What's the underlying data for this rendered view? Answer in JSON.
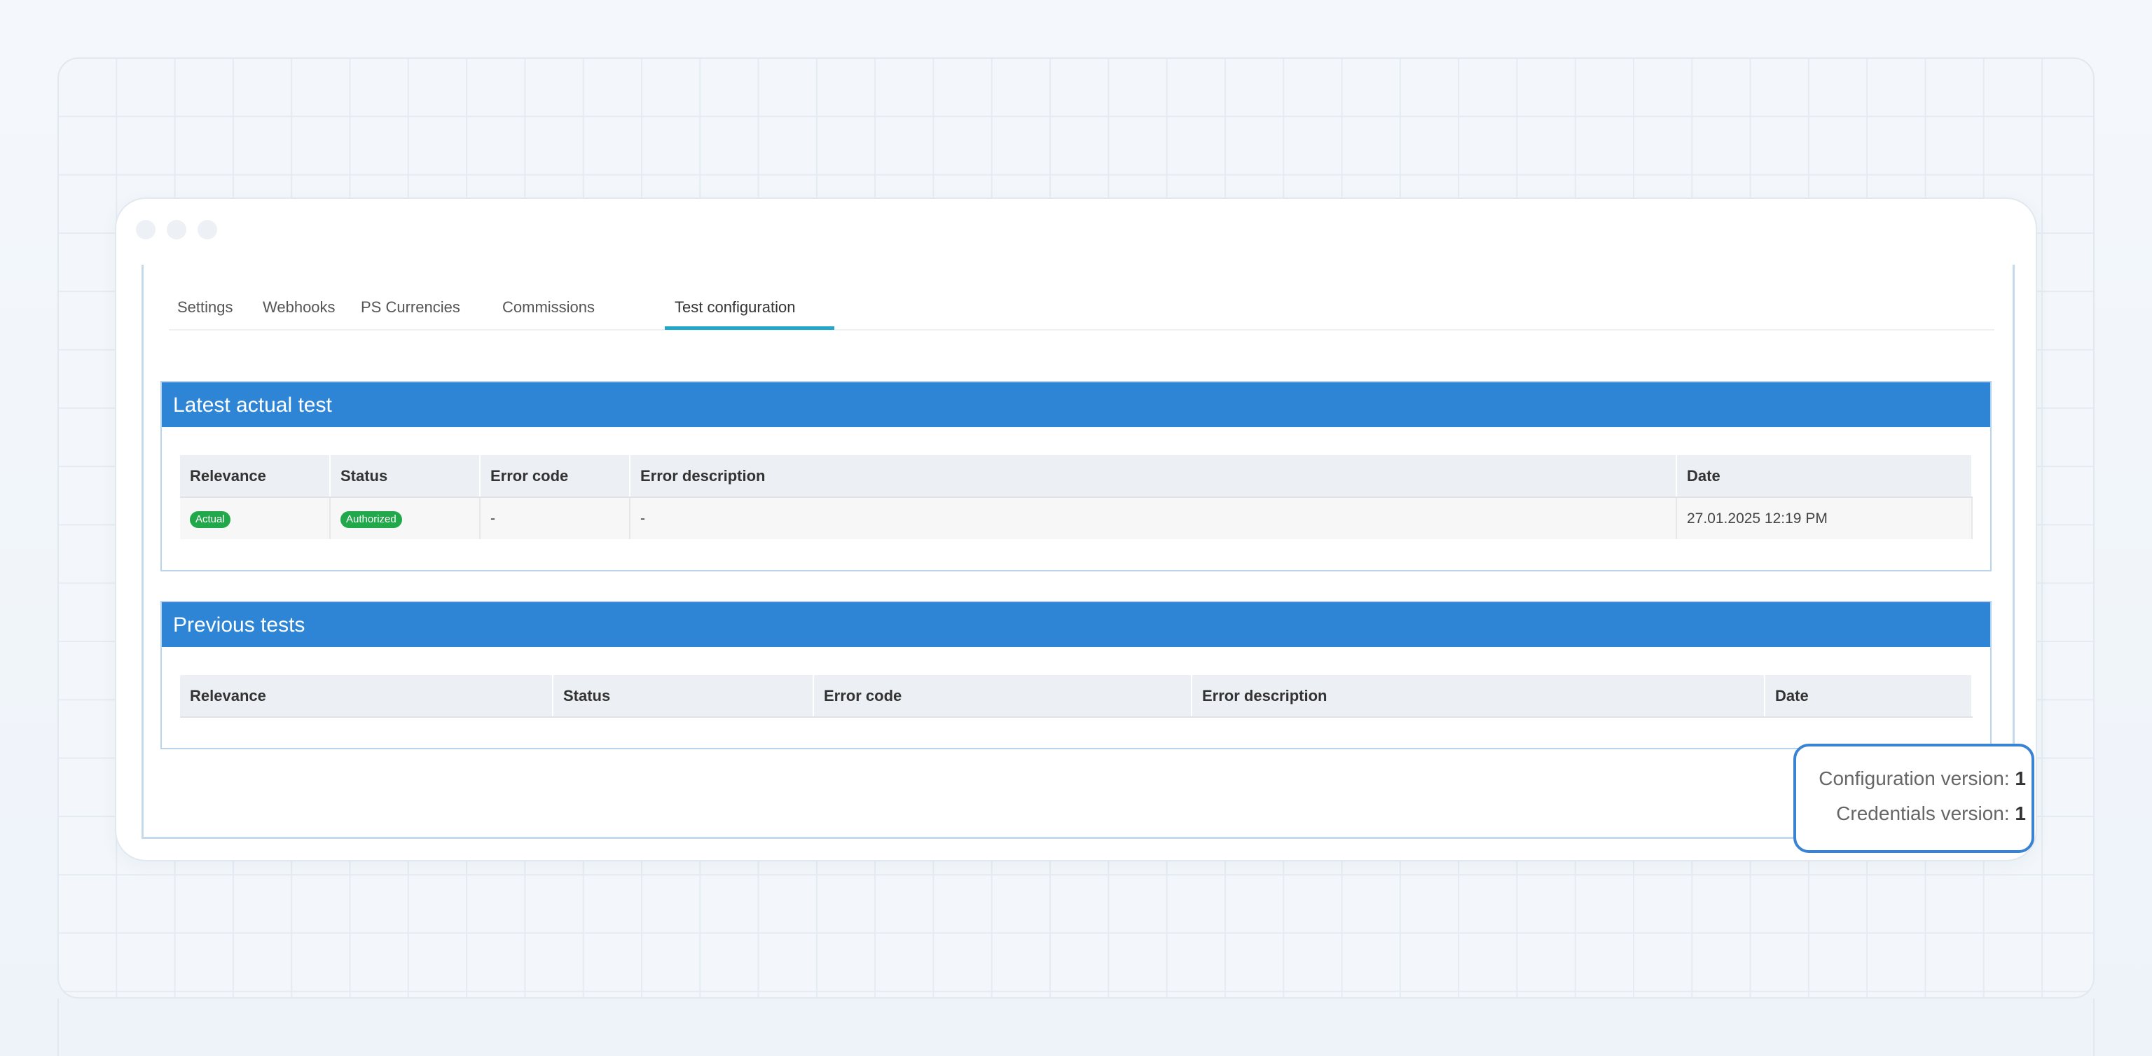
{
  "tabs": [
    {
      "label": "Settings"
    },
    {
      "label": "Webhooks"
    },
    {
      "label": "PS Currencies"
    },
    {
      "label": "Commissions"
    },
    {
      "label": "Test configuration"
    }
  ],
  "active_tab": "Test configuration",
  "latest": {
    "title": "Latest actual test",
    "columns": [
      "Relevance",
      "Status",
      "Error code",
      "Error description",
      "Date"
    ],
    "row": {
      "relevance": "Actual",
      "status": "Authorized",
      "error_code": "-",
      "error_description": "-",
      "date": "27.01.2025 12:19 PM"
    }
  },
  "previous": {
    "title": "Previous tests",
    "columns": [
      "Relevance",
      "Status",
      "Error code",
      "Error description",
      "Date"
    ]
  },
  "versions": {
    "config_label": "Configuration version:",
    "config_value": "1",
    "cred_label": "Credentials version:",
    "cred_value": "1"
  },
  "colors": {
    "panel_header": "#2e84d5",
    "badge": "#20a84a",
    "tab_active": "#1fa8c9",
    "highlight": "#3a82d2"
  }
}
